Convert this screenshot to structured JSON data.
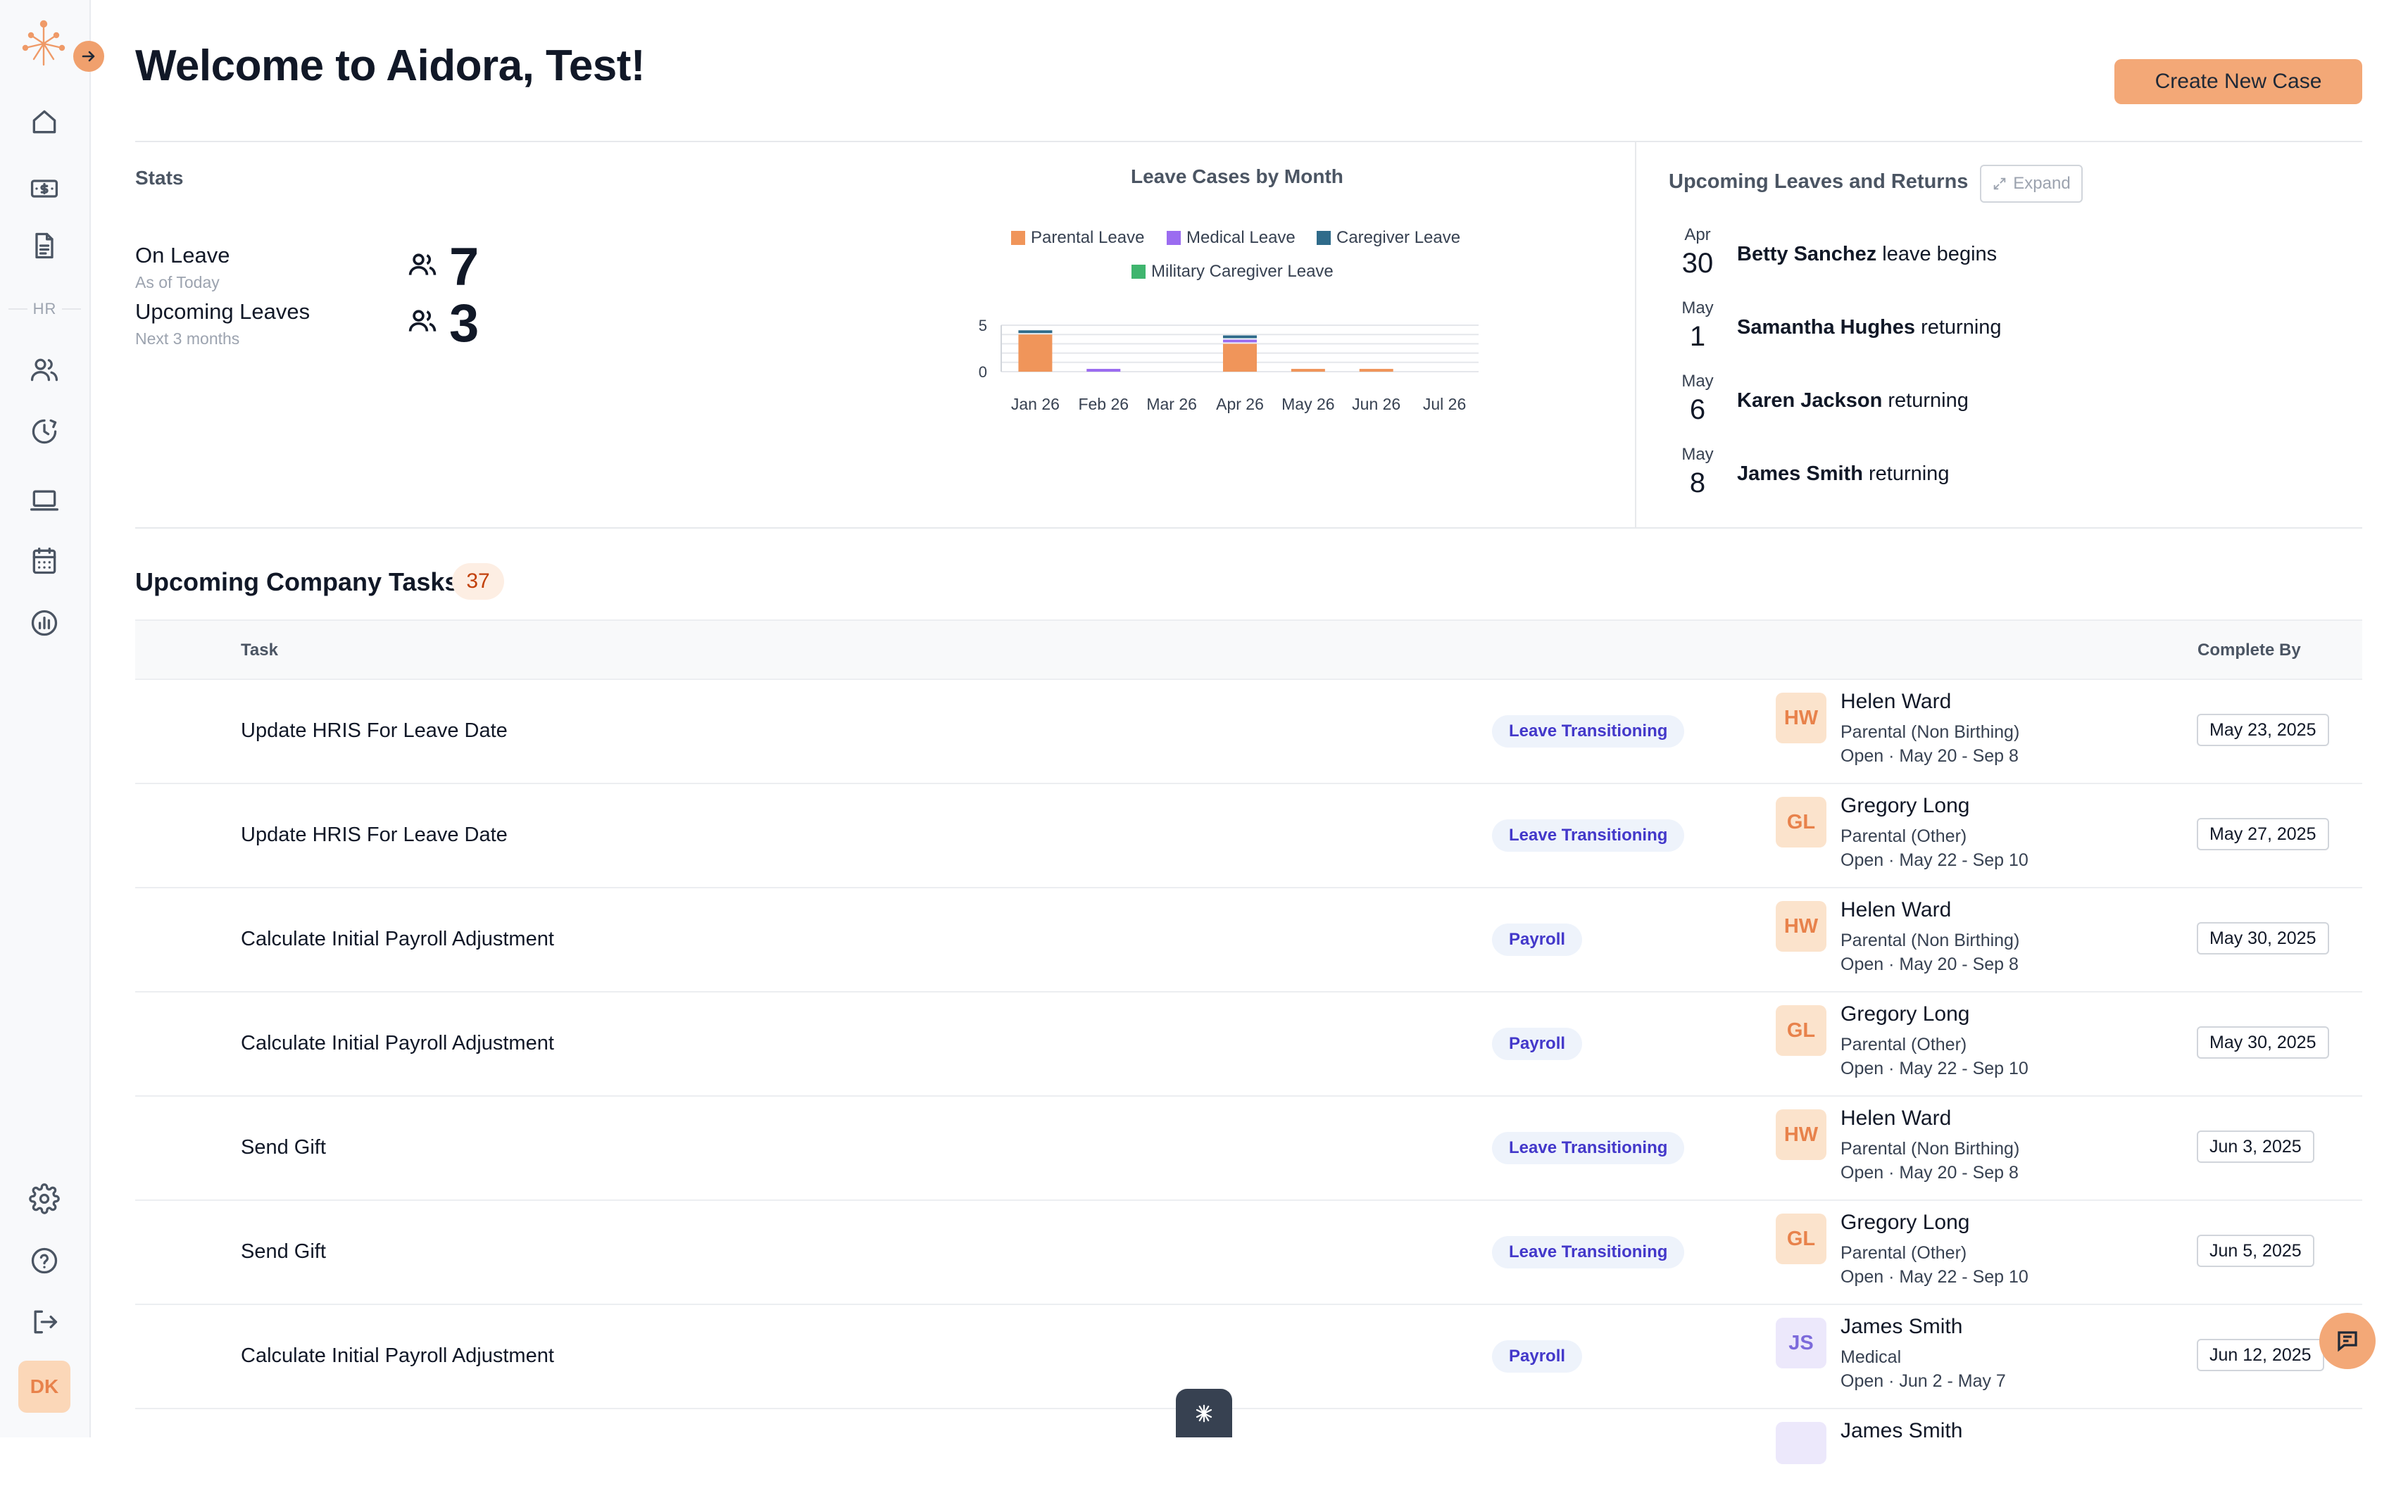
{
  "sidebar": {
    "section_label": "HR",
    "user_initials": "DK",
    "icons": [
      "home-icon",
      "payroll-icon",
      "document-icon",
      "users-icon",
      "clock-icon",
      "laptop-icon",
      "calendar-icon",
      "analytics-icon",
      "gear-icon",
      "help-icon",
      "logout-icon"
    ]
  },
  "header": {
    "title": "Welcome to Aidora, Test!",
    "create_button": "Create New Case"
  },
  "stats": {
    "label": "Stats",
    "items": [
      {
        "label": "On Leave",
        "sub": "As of Today",
        "value": "7"
      },
      {
        "label": "Upcoming Leaves",
        "sub": "Next 3 months",
        "value": "3"
      }
    ]
  },
  "chart_data": {
    "type": "bar",
    "title": "Leave Cases by Month",
    "categories": [
      "Jan 26",
      "Feb 26",
      "Mar 26",
      "Apr 26",
      "May 26",
      "Jun 26",
      "Jul 26"
    ],
    "series": [
      {
        "name": "Parental Leave",
        "color": "#f0955a",
        "values": [
          4,
          0,
          0,
          3,
          0.3,
          0.3,
          0
        ]
      },
      {
        "name": "Medical Leave",
        "color": "#9b6cf0",
        "values": [
          0,
          0.3,
          0,
          0.3,
          0,
          0,
          0
        ]
      },
      {
        "name": "Caregiver Leave",
        "color": "#2f6b8a",
        "values": [
          0.3,
          0,
          0,
          0.3,
          0,
          0,
          0
        ]
      },
      {
        "name": "Military Caregiver Leave",
        "color": "#3fb56e",
        "values": [
          0,
          0,
          0,
          0,
          0,
          0,
          0
        ]
      }
    ],
    "yticks": [
      "5",
      "0"
    ],
    "ylim": [
      0,
      5
    ],
    "xlabel": "",
    "ylabel": "",
    "grid": true,
    "legend": "top"
  },
  "upcoming": {
    "title": "Upcoming Leaves and Returns",
    "expand_label": "Expand",
    "events": [
      {
        "month": "Apr",
        "day": "30",
        "name": "Betty Sanchez",
        "action": "leave begins"
      },
      {
        "month": "May",
        "day": "1",
        "name": "Samantha Hughes",
        "action": "returning"
      },
      {
        "month": "May",
        "day": "6",
        "name": "Karen Jackson",
        "action": "returning"
      },
      {
        "month": "May",
        "day": "8",
        "name": "James Smith",
        "action": "returning"
      }
    ]
  },
  "tasks": {
    "title": "Upcoming Company Tasks",
    "count": "37",
    "columns": {
      "task": "Task",
      "complete_by": "Complete By"
    },
    "rows": [
      {
        "task": "Update HRIS For Leave Date",
        "tag": "Leave Transitioning",
        "initials": "HW",
        "name": "Helen Ward",
        "leave_type": "Parental (Non Birthing)",
        "status": "Open · May 20 - Sep 8",
        "date": "May 23, 2025"
      },
      {
        "task": "Update HRIS For Leave Date",
        "tag": "Leave Transitioning",
        "initials": "GL",
        "name": "Gregory Long",
        "leave_type": "Parental (Other)",
        "status": "Open · May 22 - Sep 10",
        "date": "May 27, 2025"
      },
      {
        "task": "Calculate Initial Payroll Adjustment",
        "tag": "Payroll",
        "initials": "HW",
        "name": "Helen Ward",
        "leave_type": "Parental (Non Birthing)",
        "status": "Open · May 20 - Sep 8",
        "date": "May 30, 2025"
      },
      {
        "task": "Calculate Initial Payroll Adjustment",
        "tag": "Payroll",
        "initials": "GL",
        "name": "Gregory Long",
        "leave_type": "Parental (Other)",
        "status": "Open · May 22 - Sep 10",
        "date": "May 30, 2025"
      },
      {
        "task": "Send Gift",
        "tag": "Leave Transitioning",
        "initials": "HW",
        "name": "Helen Ward",
        "leave_type": "Parental (Non Birthing)",
        "status": "Open · May 20 - Sep 8",
        "date": "Jun 3, 2025"
      },
      {
        "task": "Send Gift",
        "tag": "Leave Transitioning",
        "initials": "GL",
        "name": "Gregory Long",
        "leave_type": "Parental (Other)",
        "status": "Open · May 22 - Sep 10",
        "date": "Jun 5, 2025"
      },
      {
        "task": "Calculate Initial Payroll Adjustment",
        "tag": "Payroll",
        "initials": "JS",
        "name": "James Smith",
        "leave_type": "Medical",
        "status": "Open · Jun 2 - May 7",
        "date": "Jun 12, 2025"
      },
      {
        "task": "",
        "tag": "",
        "initials": "",
        "name": "James Smith",
        "leave_type": "",
        "status": "",
        "date": ""
      }
    ]
  }
}
